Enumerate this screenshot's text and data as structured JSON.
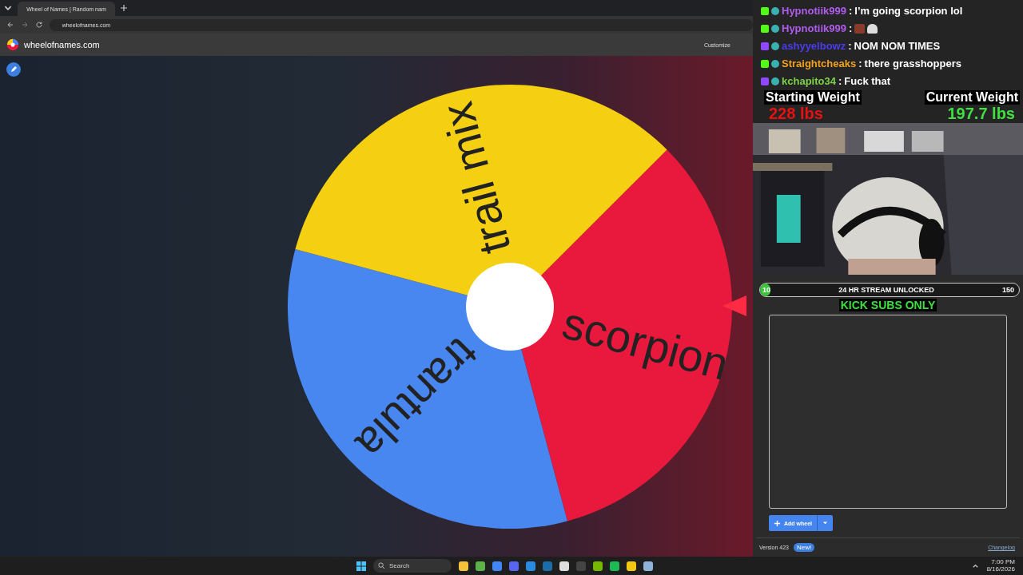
{
  "browser": {
    "tab_title": "Wheel of Names | Random nam",
    "url": "wheelofnames.com"
  },
  "site": {
    "name": "wheelofnames.com",
    "toolbar": [
      "Customize"
    ]
  },
  "wheel": {
    "slices": [
      {
        "label": "scorpion",
        "color": "#e8193c"
      },
      {
        "label": "trantula",
        "color": "#4886f0"
      },
      {
        "label": "trail mix",
        "color": "#f4cf12"
      }
    ]
  },
  "chat": [
    {
      "kind": "kick",
      "user": "Hypnotiik999",
      "color": "#b05cf0",
      "separator": ":",
      "message": "I’m going scorpion lol"
    },
    {
      "kind": "kick",
      "user": "Hypnotiik999",
      "color": "#b05cf0",
      "separator": ":",
      "emotes": true
    },
    {
      "kind": "twitch",
      "user": "ashyyelbowz",
      "color": "#4a3cf0",
      "separator": ":",
      "message": "NOM NOM TIMES"
    },
    {
      "kind": "kick",
      "user": "Straightcheaks",
      "color": "#f0a020",
      "separator": ":",
      "message": "there grasshoppers"
    },
    {
      "kind": "twitch",
      "user": "kchapito34",
      "color": "#7ed24a",
      "separator": ":",
      "message": "Fuck that"
    }
  ],
  "weights": [
    {
      "label": "Starting Weight",
      "value": "228 lbs",
      "color": "#e81010"
    },
    {
      "label": "Current Weight",
      "value": "197.7 lbs",
      "color": "#40e040"
    }
  ],
  "goal": {
    "start": "10",
    "title": "24 HR STREAM UNLOCKED",
    "end": "150",
    "level": 0.04,
    "note": "KICK SUBS ONLY"
  },
  "panel": {
    "add_button": "Add wheel",
    "version": "Version 423",
    "badge": "New!",
    "link": "Changelog"
  },
  "taskbar": {
    "search_placeholder": "Search",
    "time": "7:00 PM",
    "date": "8/16/2026"
  }
}
